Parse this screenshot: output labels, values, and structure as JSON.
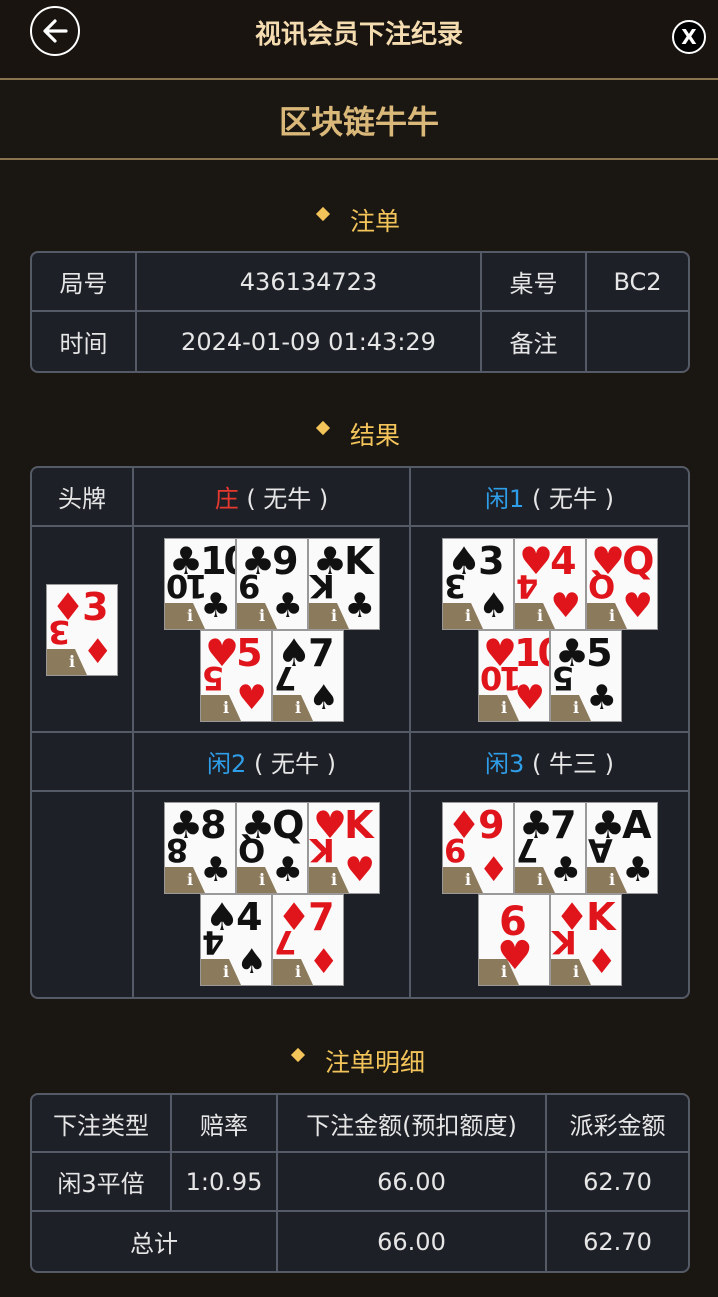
{
  "header": {
    "back_icon": "arrow-left-icon",
    "title": "视讯会员下注纪录",
    "close_label": "X"
  },
  "game": {
    "title": "区块链牛牛"
  },
  "bet_section": {
    "title": "注单",
    "round_label": "局号",
    "round_value": "436134723",
    "table_label": "桌号",
    "table_value": "BC2",
    "time_label": "时间",
    "time_value": "2024-01-09 01:43:29",
    "remark_label": "备注",
    "remark_value": ""
  },
  "result_section": {
    "title": "结果",
    "head_card_label": "头牌",
    "banker": {
      "name": "庄",
      "result": " ( 无牛 )"
    },
    "player1": {
      "name": "闲1",
      "result": " ( 无牛 )"
    },
    "player2": {
      "name": "闲2",
      "result": " ( 无牛 )"
    },
    "player3": {
      "name": "闲3",
      "result": " ( 牛三 )"
    },
    "info_label": "i"
  },
  "detail_section": {
    "title": "注单明细",
    "headers": [
      "下注类型",
      "赔率",
      "下注金额(预扣额度)",
      "派彩金额"
    ],
    "rows": [
      {
        "type": "闲3平倍",
        "odds": "1:0.95",
        "amount": "66.00",
        "payout": "62.70"
      }
    ],
    "total": {
      "label": "总计",
      "amount": "66.00",
      "payout": "62.70"
    }
  },
  "colors": {
    "accent_gold": "#f2c45a",
    "title_gold": "#d9b87a",
    "banker_red": "#e8392e",
    "player_blue": "#2f9ee8",
    "odds_red": "#d42a2a"
  }
}
